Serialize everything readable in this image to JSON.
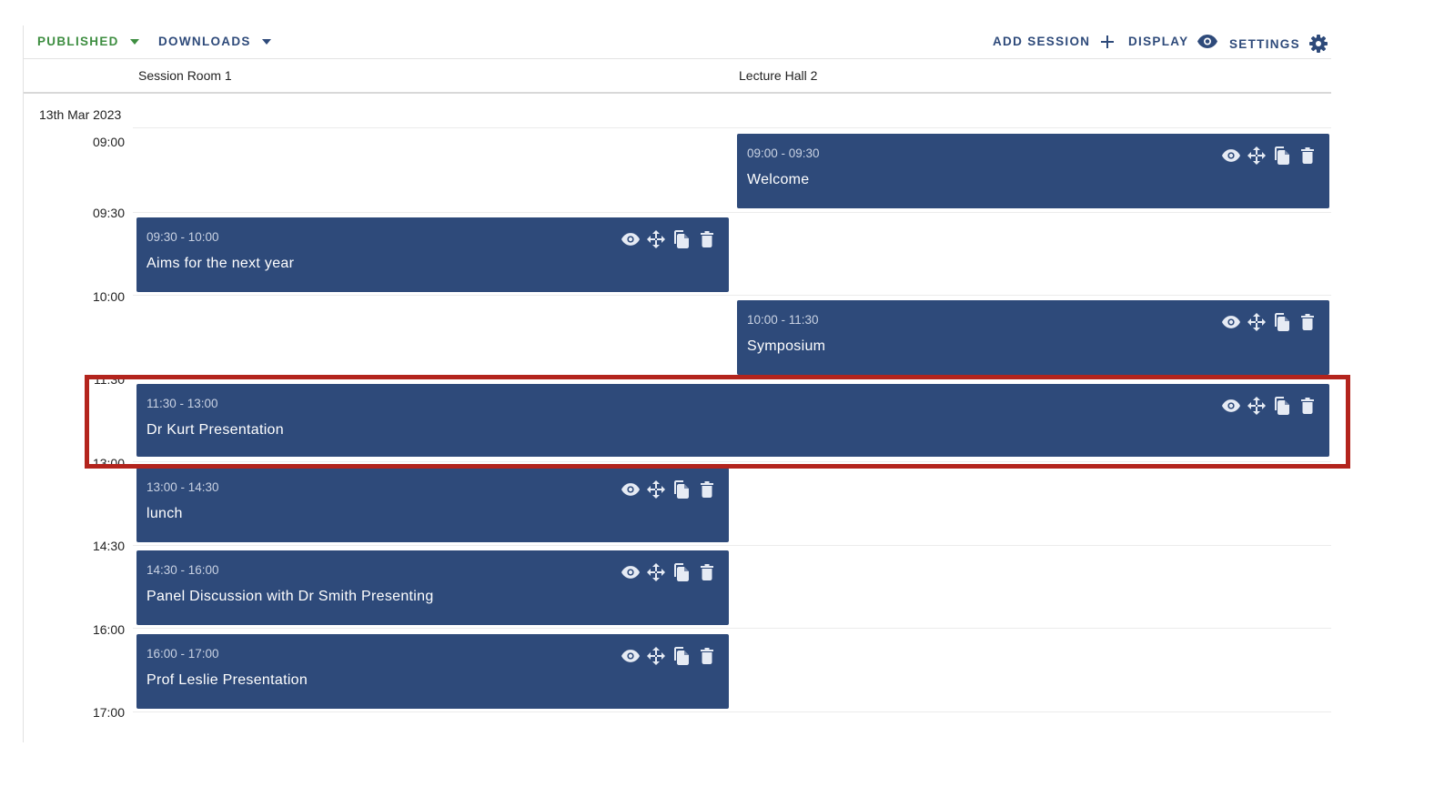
{
  "toolbar": {
    "published_label": "PUBLISHED",
    "downloads_label": "DOWNLOADS",
    "add_session_label": "ADD SESSION",
    "display_label": "DISPLAY",
    "settings_label": "SETTINGS"
  },
  "rooms": [
    "Session Room 1",
    "Lecture Hall 2"
  ],
  "date": "13th Mar 2023",
  "times": [
    "09:00",
    "09:30",
    "10:00",
    "11:30",
    "13:00",
    "14:30",
    "16:00",
    "17:00"
  ],
  "sessions": [
    {
      "room": "Lecture Hall 2",
      "range": "09:00 - 09:30",
      "title": "Welcome"
    },
    {
      "room": "Session Room 1",
      "range": "09:30 - 10:00",
      "title": "Aims for the next year"
    },
    {
      "room": "Lecture Hall 2",
      "range": "10:00 - 11:30",
      "title": "Symposium"
    },
    {
      "room": "Both rooms",
      "range": "11:30 - 13:00",
      "title": "Dr Kurt Presentation"
    },
    {
      "room": "Session Room 1",
      "range": "13:00 - 14:30",
      "title": "lunch"
    },
    {
      "room": "Session Room 1",
      "range": "14:30 - 16:00",
      "title": "Panel Discussion with Dr Smith Presenting"
    },
    {
      "room": "Session Room 1",
      "range": "16:00 - 17:00",
      "title": "Prof Leslie Presentation"
    }
  ],
  "icons": {
    "session_actions": [
      "eye-icon",
      "move-icon",
      "copy-icon",
      "trash-icon"
    ],
    "toolbar": [
      "chevron-down-icon",
      "plus-icon",
      "eye-icon",
      "gear-icon"
    ]
  },
  "colors": {
    "session_bg": "#2e4a7a",
    "published": "#3e8e41",
    "toolbar_text": "#2e4a7a",
    "highlight": "#b3241d"
  }
}
